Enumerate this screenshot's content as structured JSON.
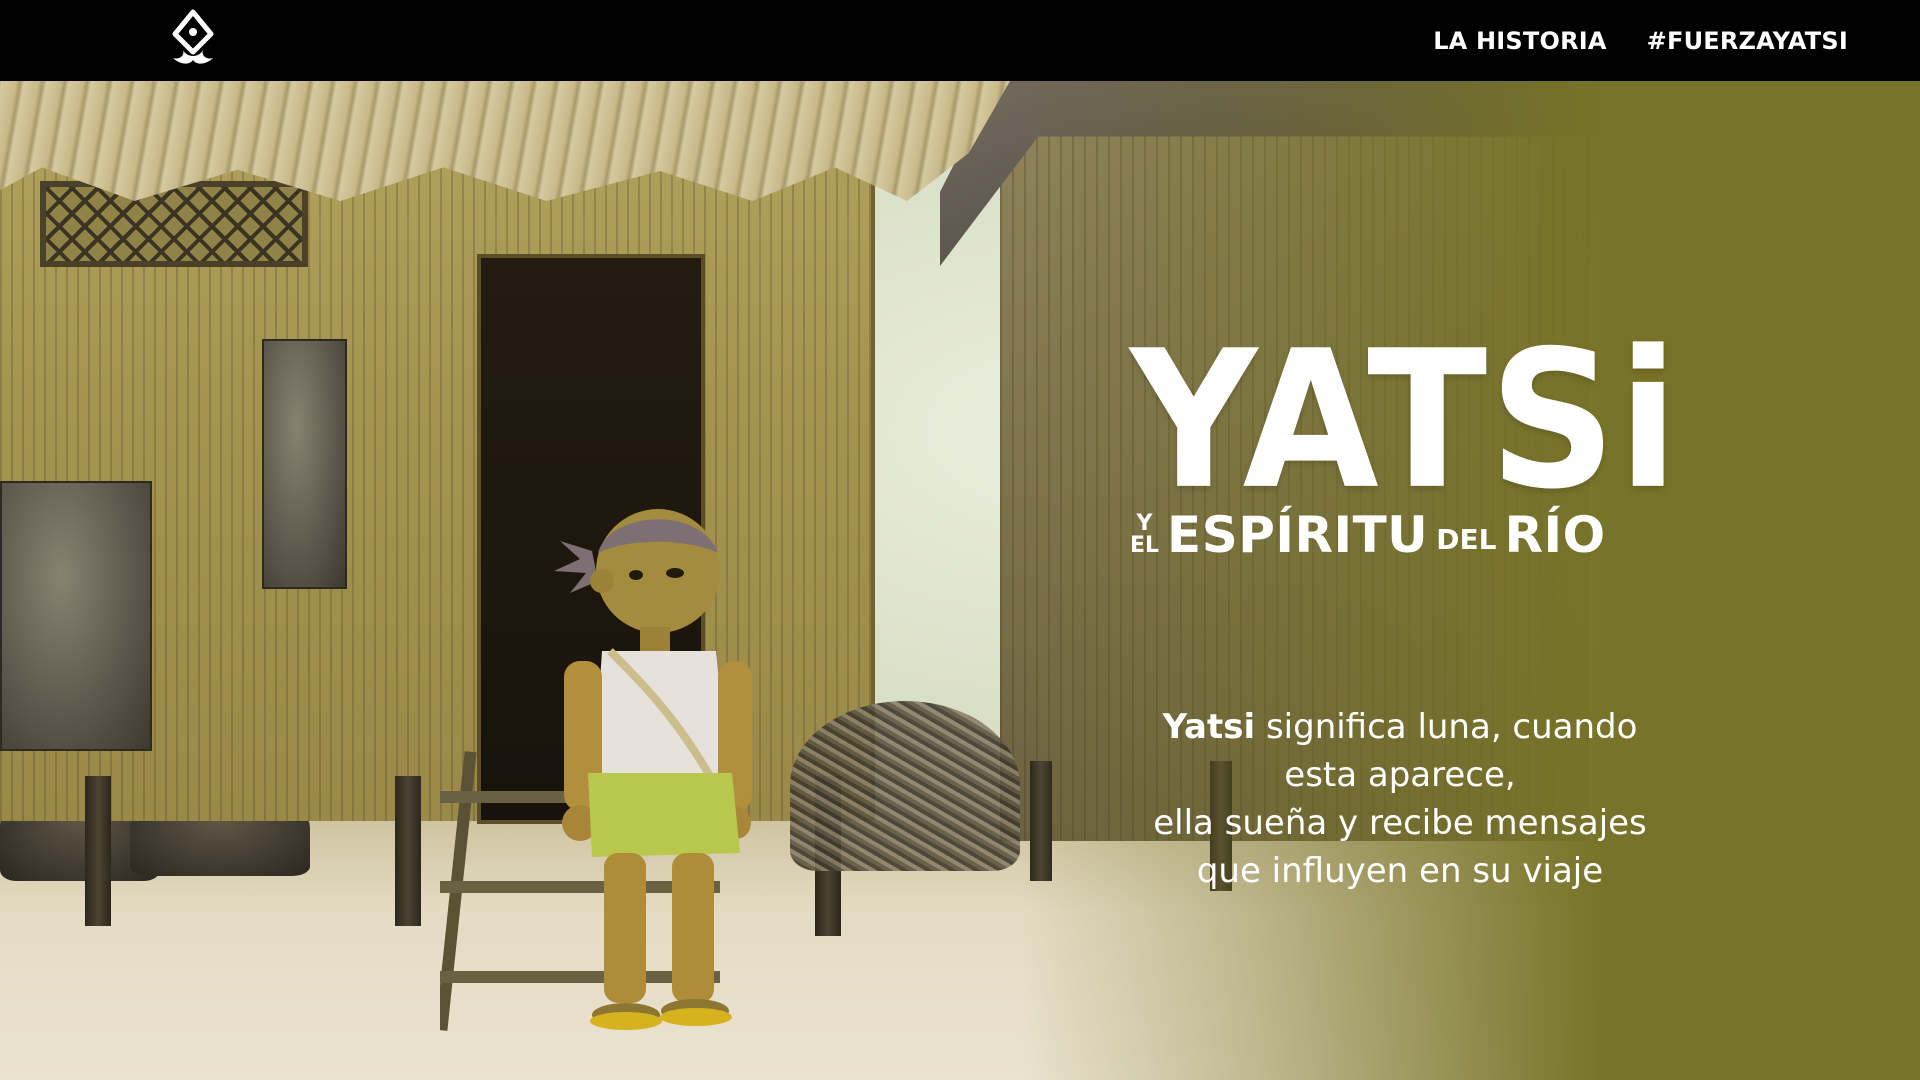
{
  "header": {
    "logo_icon": "diamond-flame-logo-icon",
    "nav": [
      {
        "label": "LA HISTORIA"
      },
      {
        "label": "#FUERZAYATSI"
      }
    ]
  },
  "hero": {
    "title": "YATSi",
    "subtitle": {
      "y": "Y",
      "el": "EL",
      "espiritu": "ESPÍRITU",
      "del": "DEL",
      "rio": "RÍO"
    },
    "description": {
      "bold": "Yatsi",
      "line1_rest": " significa luna, cuando",
      "line2": "esta aparece,",
      "line3": "ella sueña y recibe mensajes",
      "line4": "que influyen en su viaje"
    },
    "colors": {
      "olive_panel": "#777328",
      "topbar": "#000000",
      "text": "#FFFFFF"
    }
  }
}
